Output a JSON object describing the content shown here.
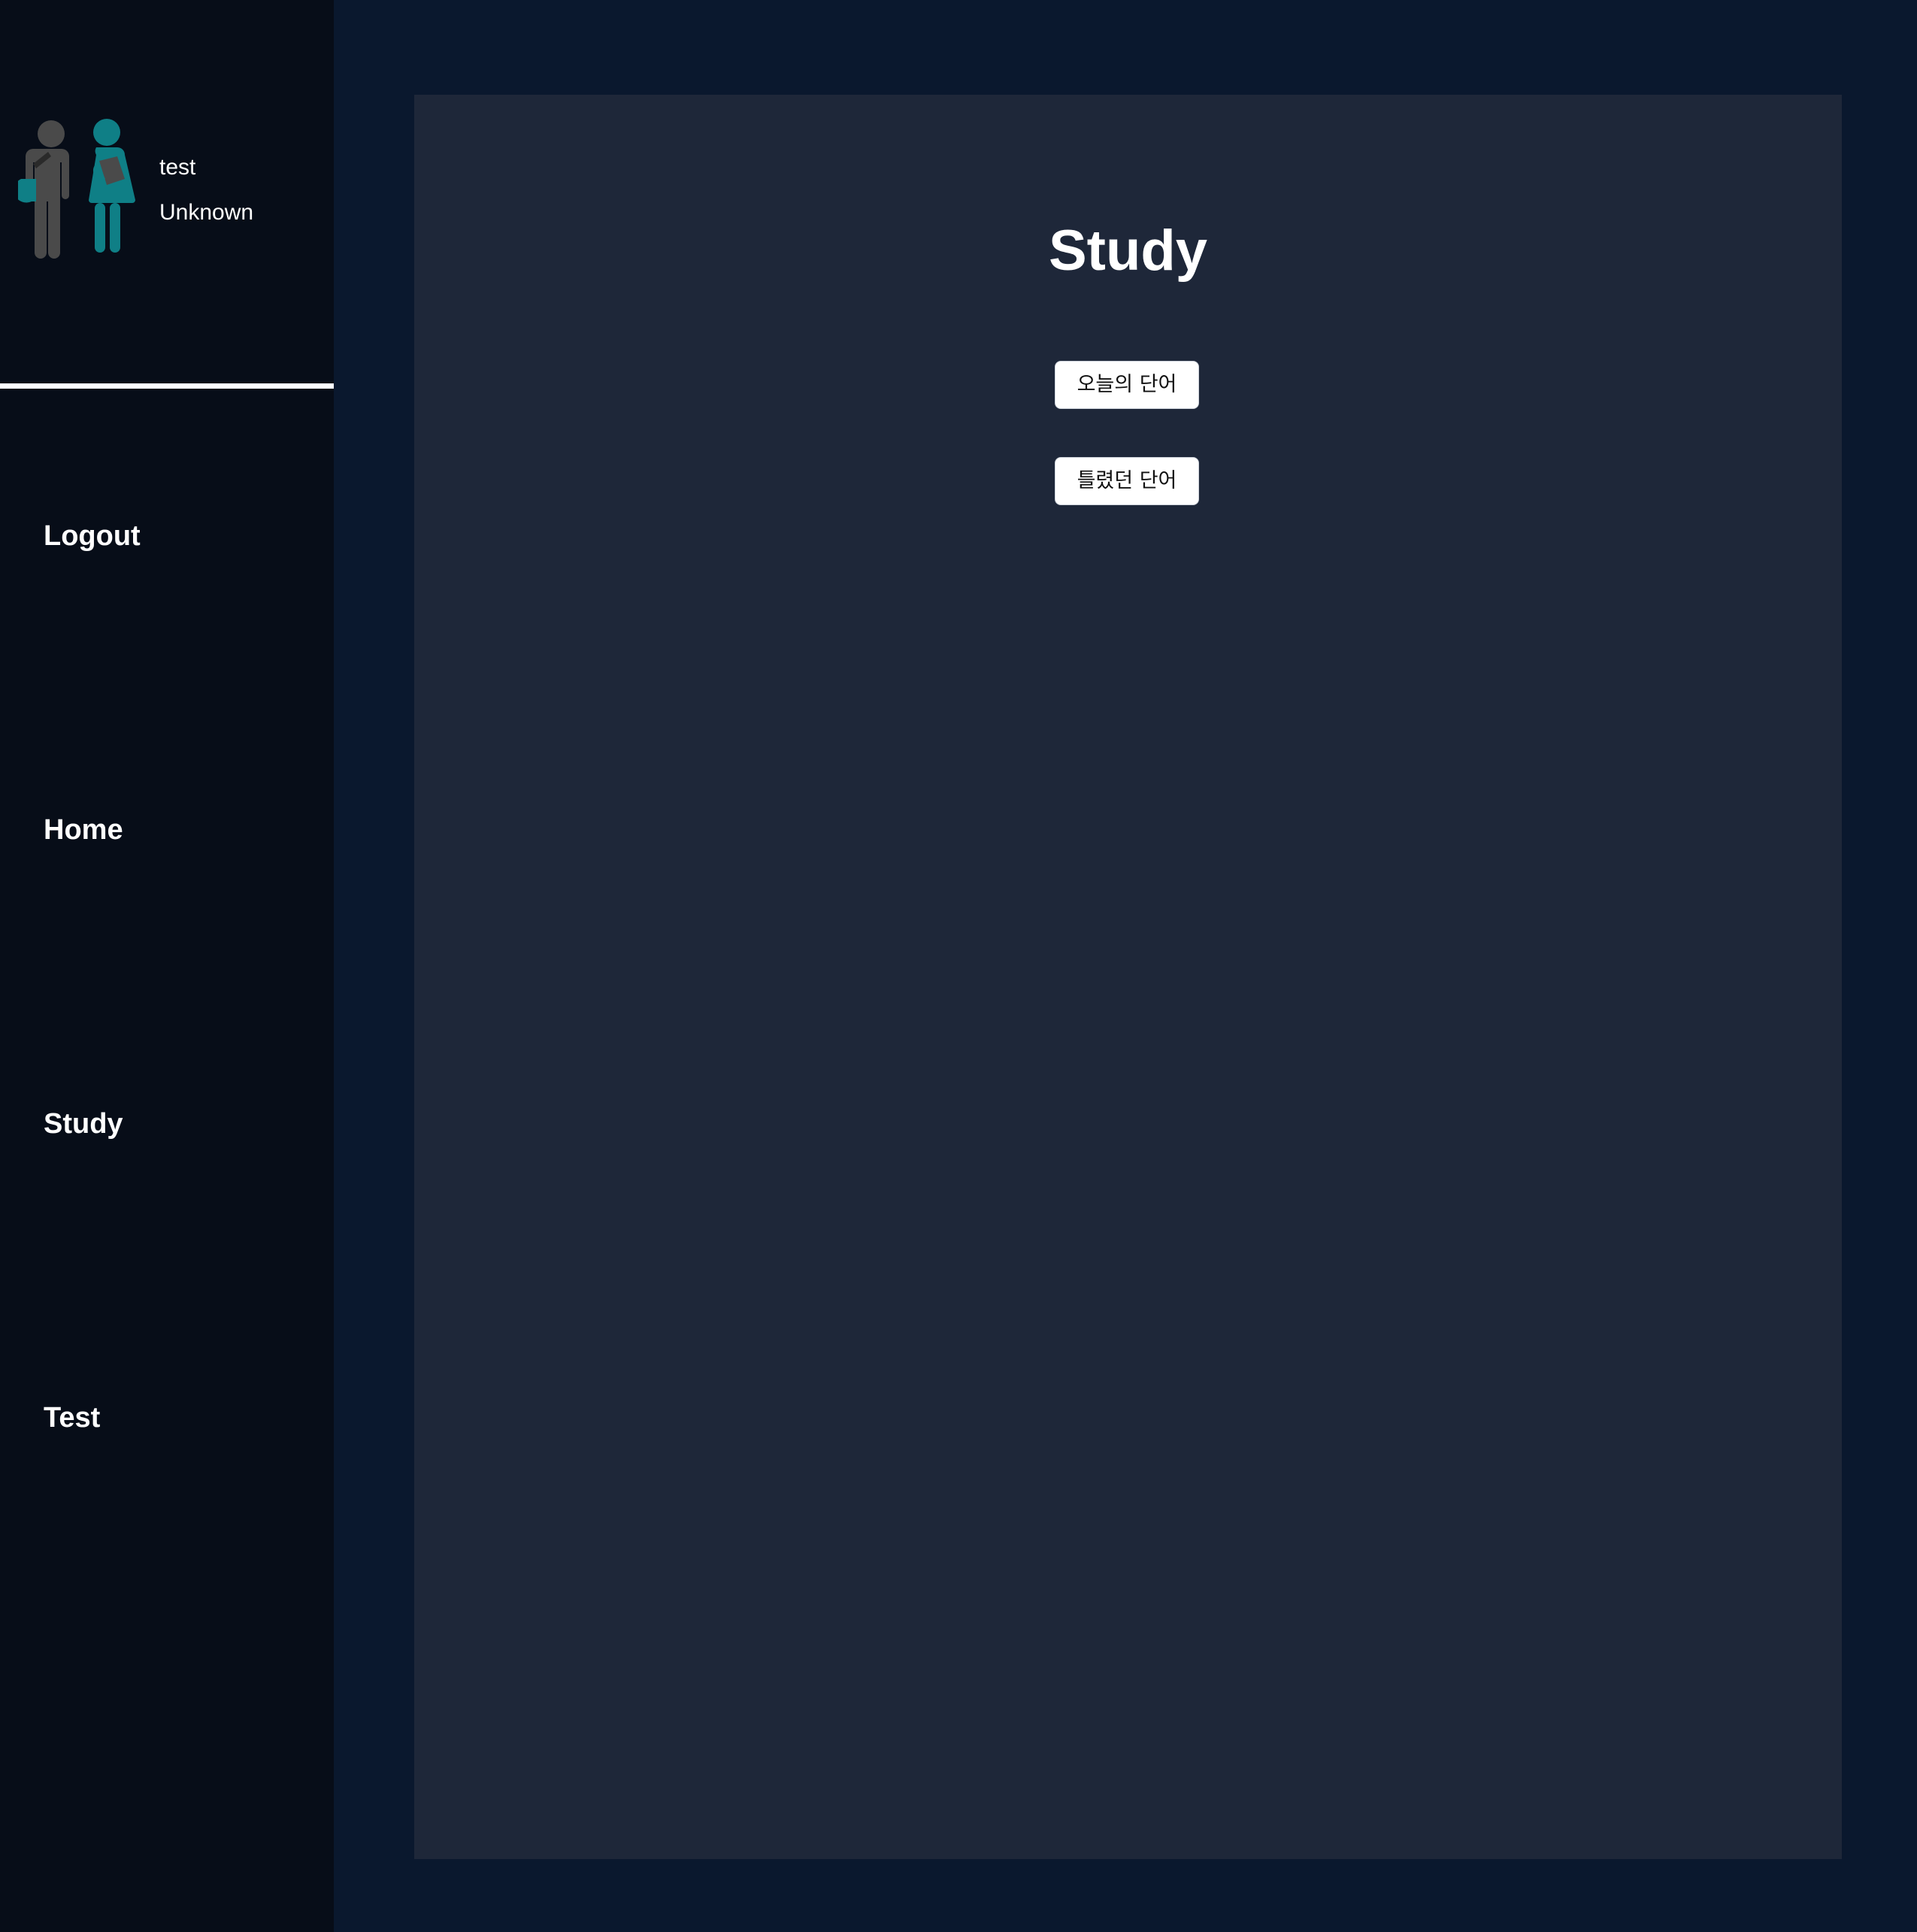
{
  "user": {
    "name": "test",
    "role": "Unknown",
    "avatar_icon": "students-icon"
  },
  "sidebar": {
    "items": [
      {
        "label": "Logout"
      },
      {
        "label": "Home"
      },
      {
        "label": "Study"
      },
      {
        "label": "Test"
      }
    ]
  },
  "main": {
    "title": "Study",
    "buttons": [
      {
        "label": "오늘의 단어"
      },
      {
        "label": "틀렸던 단어"
      }
    ]
  },
  "colors": {
    "page_background": "#0a182e",
    "sidebar_background": "#070d18",
    "panel_background": "#1e2739",
    "avatar_gray": "#4a4a4a",
    "avatar_teal": "#0f7f86"
  }
}
